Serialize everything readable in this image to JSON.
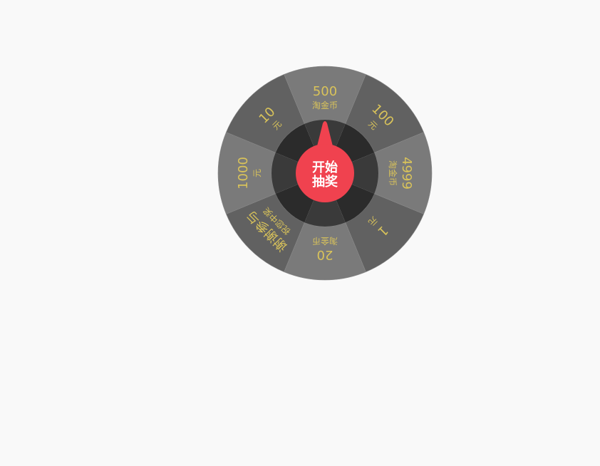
{
  "wheel": {
    "prizes": [
      {
        "amount": "500",
        "unit": "淘金币"
      },
      {
        "amount": "100",
        "unit": "元"
      },
      {
        "amount": "4999",
        "unit": "淘金币"
      },
      {
        "amount": "1",
        "unit": "元"
      },
      {
        "amount": "20",
        "unit": "淘金币"
      },
      {
        "amount": "谢谢参与",
        "unit": "祝您中奖"
      },
      {
        "amount": "1000",
        "unit": "元"
      },
      {
        "amount": "10",
        "unit": "元"
      }
    ],
    "colors": {
      "light_segment": "#7a7a7a",
      "dark_segment": "#616161",
      "divider": "#8a8a8a",
      "inner_ring_light": "#3a3a3a",
      "inner_ring_dark": "#2b2b2b",
      "prize_text": "#d9c35a",
      "button": "#f0424f",
      "button_text": "#ffffff",
      "page_bg": "#f9f9f9"
    },
    "start_button": {
      "line1": "开始",
      "line2": "抽奖"
    }
  }
}
